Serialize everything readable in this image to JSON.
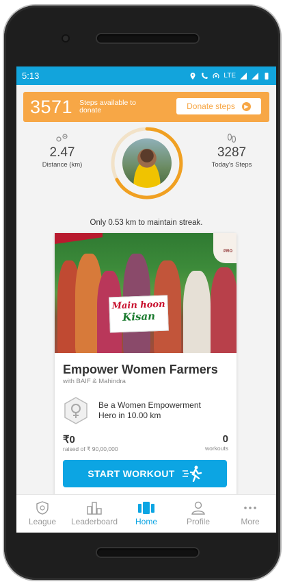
{
  "status": {
    "time": "5:13",
    "icons": [
      "location-icon",
      "lte-call-icon",
      "hotspot-icon",
      "lte-signal-icon",
      "signal-icon",
      "battery-icon"
    ],
    "lte_label": "LTE"
  },
  "banner": {
    "steps": "3571",
    "subtitle": "Steps available to donate",
    "donate_label": "Donate steps"
  },
  "stats": {
    "distance": {
      "value": "2.47",
      "label": "Distance (km)"
    },
    "steps": {
      "value": "3287",
      "label": "Today's Steps"
    }
  },
  "streak_text": "Only 0.53 km to maintain streak.",
  "campaign": {
    "sign_line1": "Main hoon",
    "sign_line2": "Kisan",
    "title": "Empower Women Farmers",
    "partners": "with BAIF & Mahindra",
    "badge_text": "Be a Women Empowerment Hero in 10.00 km",
    "raised": "₹0",
    "raised_of": "raised of ₹ 90,00,000",
    "workouts": "0",
    "workouts_label": "workouts",
    "start_label": "START WORKOUT"
  },
  "tabs": [
    {
      "label": "League",
      "icon": "league-shield-icon"
    },
    {
      "label": "Leaderboard",
      "icon": "leaderboard-icon"
    },
    {
      "label": "Home",
      "icon": "home-icon"
    },
    {
      "label": "Profile",
      "icon": "profile-icon"
    },
    {
      "label": "More",
      "icon": "more-dots-icon"
    }
  ],
  "colors": {
    "accent": "#0ca5e3",
    "banner": "#f7a746",
    "status_bar": "#12a4dc"
  }
}
